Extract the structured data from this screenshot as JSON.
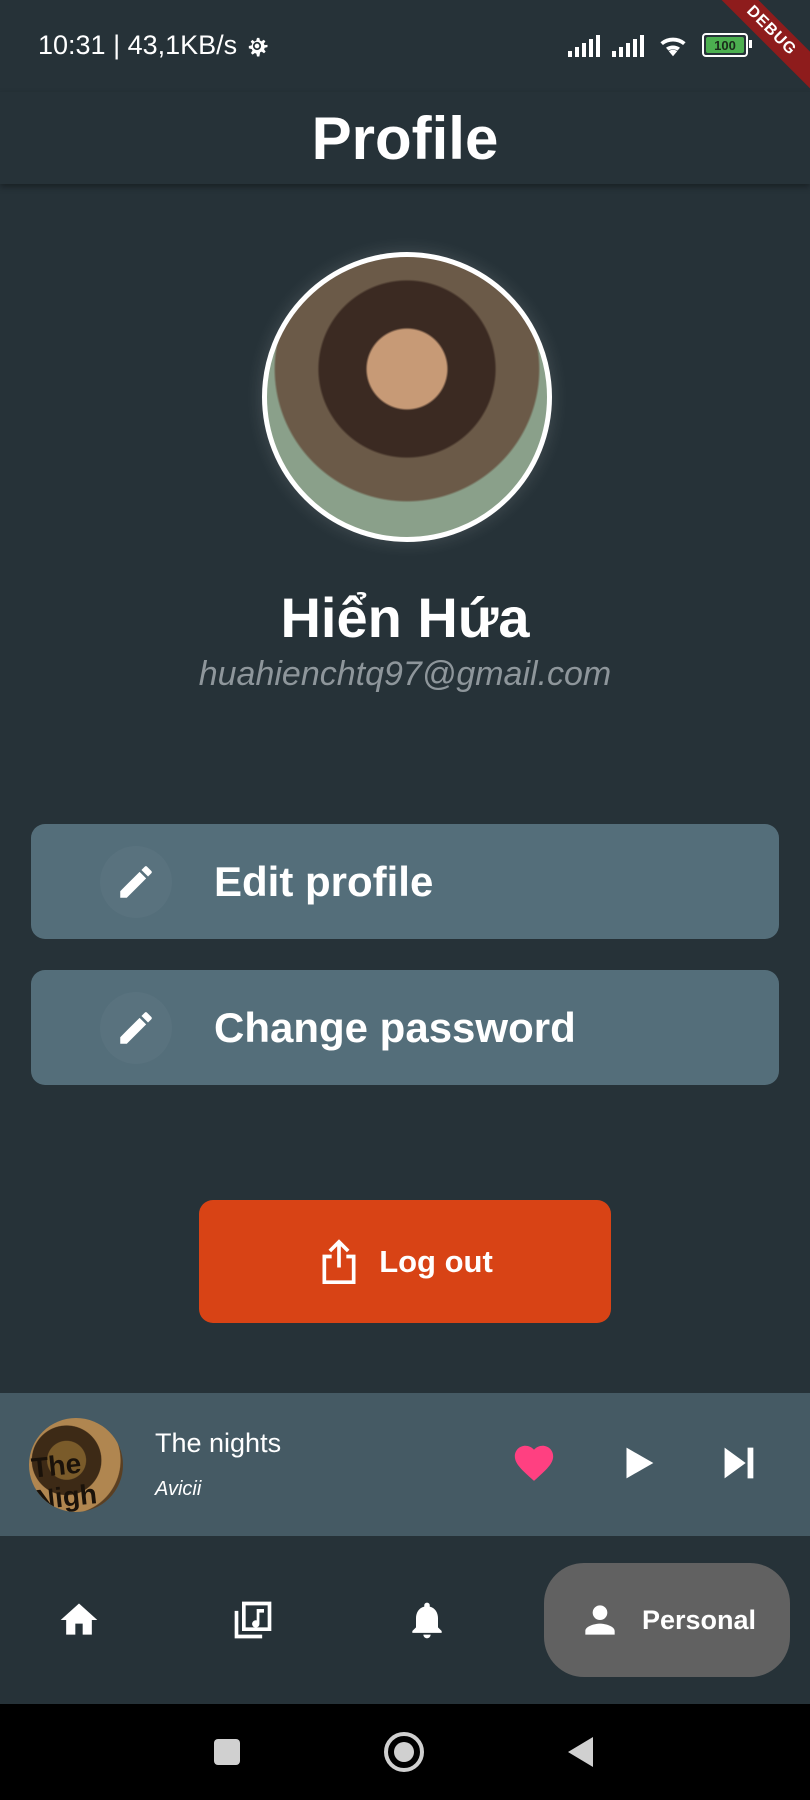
{
  "status_bar": {
    "time_speed": "10:31 | 43,1KB/s",
    "battery": "100",
    "debug_label": "DEBUG"
  },
  "app_bar": {
    "title": "Profile"
  },
  "profile": {
    "name": "Hiển Hứa",
    "email": "huahienchtq97@gmail.com"
  },
  "actions": {
    "edit_profile": "Edit profile",
    "change_password": "Change password",
    "logout": "Log out"
  },
  "mini_player": {
    "title": "The nights",
    "artist": "Avicii",
    "cover_text": "The Nigh"
  },
  "bottom_nav": {
    "active_label": "Personal"
  },
  "colors": {
    "background": "#263238",
    "button": "#546e7a",
    "logout": "#d84315",
    "player": "#455a64",
    "heart": "#ff4081",
    "nav_active": "#616161"
  }
}
